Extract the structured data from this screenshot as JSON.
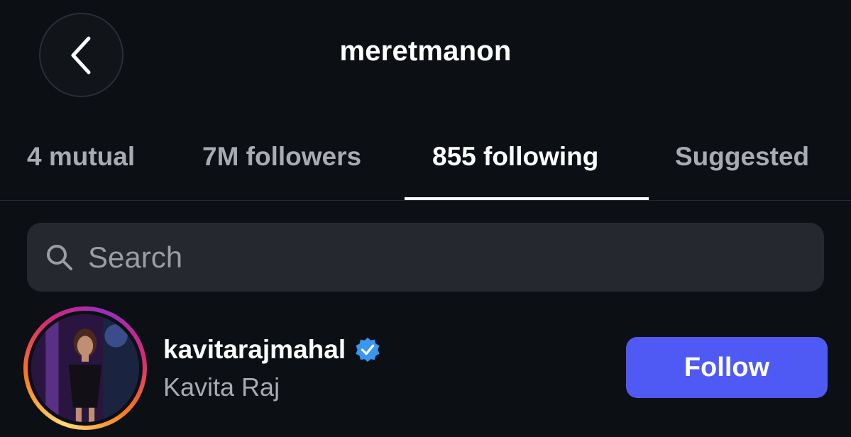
{
  "header": {
    "title": "meretmanon",
    "back_icon": "chevron-left-icon"
  },
  "tabs": [
    {
      "label": "4 mutual",
      "active": false
    },
    {
      "label": "7M followers",
      "active": false
    },
    {
      "label": "855 following",
      "active": true
    },
    {
      "label": "Suggested",
      "active": false
    }
  ],
  "search": {
    "placeholder": "Search",
    "value": "",
    "icon": "search-icon"
  },
  "list": [
    {
      "username": "kavitarajmahal",
      "verified": true,
      "full_name": "Kavita Raj",
      "follow_label": "Follow"
    }
  ],
  "colors": {
    "background": "#0c0f14",
    "follow_button": "#4f5af5",
    "verified_badge": "#3897f0",
    "inactive_tab": "#a8abb1"
  }
}
